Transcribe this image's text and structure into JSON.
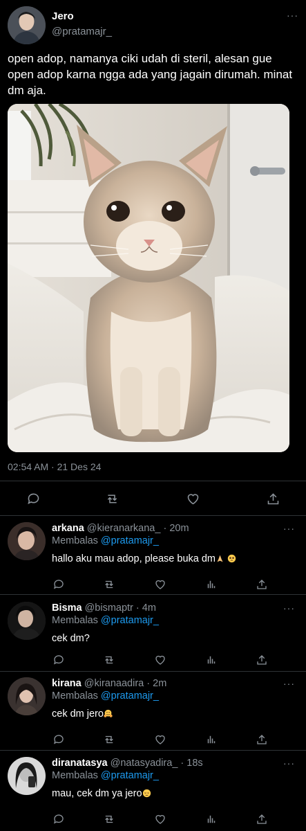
{
  "tweet": {
    "author_name": "Jero",
    "author_handle": "@pratamajr_",
    "more_label": "···",
    "text": "open adop, namanya ciki udah di steril, alesan gue open adop karna ngga ada yang jagain dirumah. minat dm aja.",
    "timestamp": "02:54 AM · 21 Des 24",
    "media_description_icon": "cat-photo"
  },
  "tweet_actions": [
    {
      "name": "reply-icon"
    },
    {
      "name": "retweet-icon"
    },
    {
      "name": "like-icon"
    },
    {
      "name": "share-icon"
    }
  ],
  "replies": [
    {
      "name": "arkana",
      "handle": "@kieranarkana_",
      "time": "20m",
      "replying_label": "Membalas",
      "replying_to": "@pratamajr_",
      "text": "hallo aku mau adop, please buka dm",
      "emojis": [
        "folded-hands",
        "pleading-face"
      ]
    },
    {
      "name": "Bisma",
      "handle": "@bismaptr",
      "time": "4m",
      "replying_label": "Membalas",
      "replying_to": "@pratamajr_",
      "text": "cek dm?",
      "emojis": []
    },
    {
      "name": "kirana",
      "handle": "@kiranaadira",
      "time": "2m",
      "replying_label": "Membalas",
      "replying_to": "@pratamajr_",
      "text": "cek dm jero",
      "emojis": [
        "hugging-face"
      ]
    },
    {
      "name": "diranatasya",
      "handle": "@natasyadira_",
      "time": "18s",
      "replying_label": "Membalas",
      "replying_to": "@pratamajr_",
      "text": "mau, cek dm ya jero",
      "emojis": [
        "relieved-face"
      ]
    }
  ],
  "separator": "·",
  "colors": {
    "background": "#000000",
    "text": "#e7e9ea",
    "secondary": "#8b9299",
    "link": "#1d9bf0",
    "divider": "#2f3336"
  }
}
